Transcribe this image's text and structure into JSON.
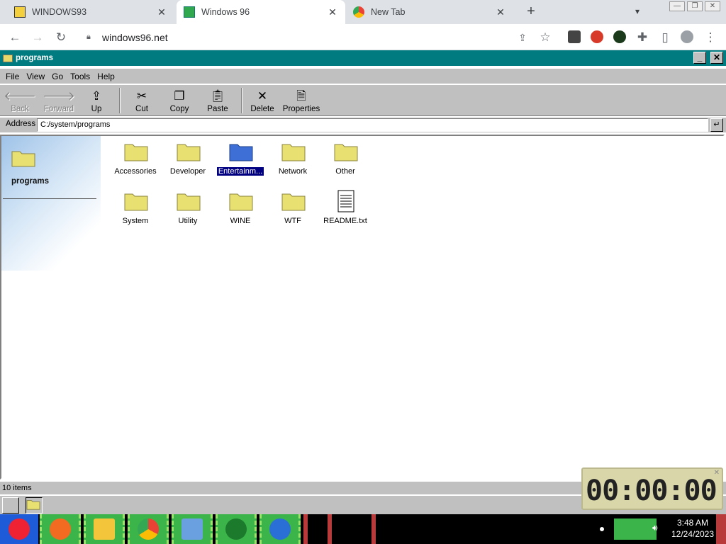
{
  "browser": {
    "tabs": [
      {
        "title": "WINDOWS93",
        "active": false
      },
      {
        "title": "Windows 96",
        "active": true
      },
      {
        "title": "New Tab",
        "active": false
      }
    ],
    "url": "windows96.net"
  },
  "window": {
    "title": "programs",
    "menu": [
      "File",
      "View",
      "Go",
      "Tools",
      "Help"
    ],
    "toolbar": {
      "back": "Back",
      "forward": "Forward",
      "up": "Up",
      "cut": "Cut",
      "copy": "Copy",
      "paste": "Paste",
      "delete": "Delete",
      "properties": "Properties"
    },
    "address_label": "Address",
    "address": "C:/system/programs",
    "sidebar_name": "programs",
    "items": [
      {
        "label": "Accessories",
        "type": "folder"
      },
      {
        "label": "Developer",
        "type": "folder"
      },
      {
        "label": "Entertainm...",
        "type": "folder",
        "selected": true
      },
      {
        "label": "Network",
        "type": "folder"
      },
      {
        "label": "Other",
        "type": "folder"
      },
      {
        "label": "System",
        "type": "folder"
      },
      {
        "label": "Utility",
        "type": "folder"
      },
      {
        "label": "WINE",
        "type": "folder"
      },
      {
        "label": "WTF",
        "type": "folder"
      },
      {
        "label": "README.txt",
        "type": "text-file"
      }
    ],
    "status": "10 items"
  },
  "clock_widget": {
    "digits": "00:00:00"
  },
  "taskbar": {
    "time": "3:48 AM",
    "date": "12/24/2023"
  },
  "colors": {
    "titlebar": "#007b80",
    "face": "#c0c0c0",
    "selection": "#000080",
    "folder": "#e8e070",
    "folder_selected": "#3d6fd6",
    "pin": "#3bb54a"
  }
}
